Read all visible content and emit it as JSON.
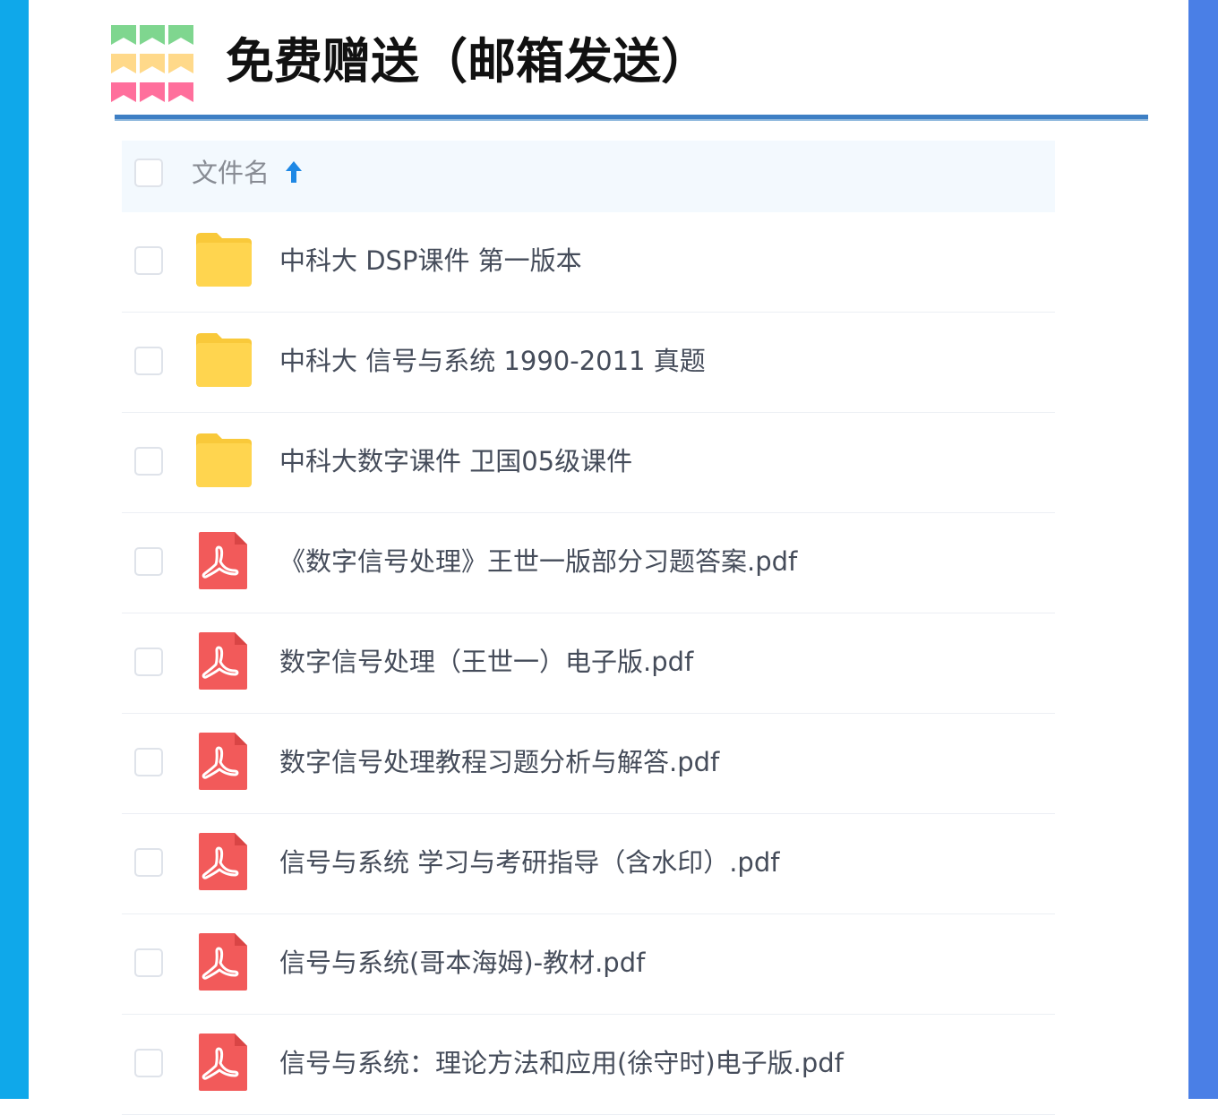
{
  "header": {
    "title": "免费赠送（邮箱发送）",
    "decoration_icon": "bunting-flags-icon"
  },
  "colors": {
    "left_bar": "#0fa8ea",
    "right_bar": "#4a7fe6",
    "underline": "#3e7fc4",
    "folder": "#ffd54f",
    "pdf": "#f25a5a",
    "header_row_bg": "#f3f9fe",
    "sort_arrow": "#1e88e5"
  },
  "table": {
    "column_label": "文件名",
    "sort_icon": "arrow-up-icon",
    "rows": [
      {
        "type": "folder",
        "icon": "folder-icon",
        "name": "中科大 DSP课件 第一版本"
      },
      {
        "type": "folder",
        "icon": "folder-icon",
        "name": "中科大 信号与系统 1990-2011 真题"
      },
      {
        "type": "folder",
        "icon": "folder-icon",
        "name": "中科大数字课件 卫国05级课件"
      },
      {
        "type": "pdf",
        "icon": "pdf-file-icon",
        "name": "《数字信号处理》王世一版部分习题答案.pdf"
      },
      {
        "type": "pdf",
        "icon": "pdf-file-icon",
        "name": "数字信号处理（王世一）电子版.pdf"
      },
      {
        "type": "pdf",
        "icon": "pdf-file-icon",
        "name": "数字信号处理教程习题分析与解答.pdf"
      },
      {
        "type": "pdf",
        "icon": "pdf-file-icon",
        "name": "信号与系统 学习与考研指导（含水印）.pdf"
      },
      {
        "type": "pdf",
        "icon": "pdf-file-icon",
        "name": "信号与系统(哥本海姆)-教材.pdf"
      },
      {
        "type": "pdf",
        "icon": "pdf-file-icon",
        "name": "信号与系统：理论方法和应用(徐守时)电子版.pdf"
      }
    ]
  }
}
